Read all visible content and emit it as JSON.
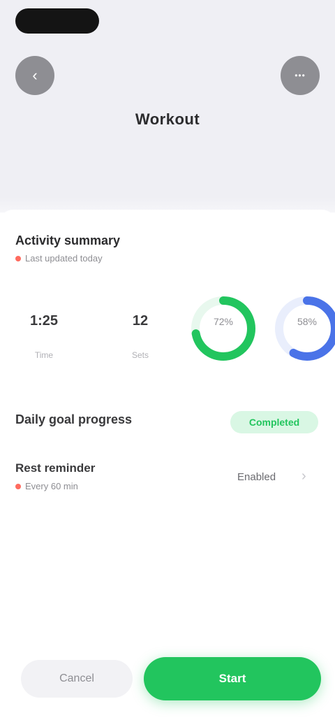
{
  "colors": {
    "accent_green": "#22c55e",
    "accent_blue": "#4a73e8",
    "warning_dot": "#ff6b5f",
    "top_background": "#efeff4"
  },
  "header": {
    "left_icon": "chevron-left-icon",
    "left_glyph": "‹",
    "right_icon": "more-icon",
    "right_glyph": "•••",
    "title": "Workout"
  },
  "summary": {
    "title": "Activity summary",
    "subtitle": "Last updated today"
  },
  "stats": [
    {
      "value": "1:25",
      "label": "Time"
    },
    {
      "value": "12",
      "label": "Sets"
    }
  ],
  "rings": [
    {
      "name": "move",
      "progress": 0.72,
      "text": "72%"
    },
    {
      "name": "exercise",
      "progress": 0.58,
      "text": "58%"
    }
  ],
  "rows": {
    "goal_label": "Daily goal progress",
    "goal_status": "Completed",
    "rest_label": "Rest reminder",
    "rest_sub": "Every 60 min",
    "rest_value": "Enabled"
  },
  "actions": {
    "secondary": "Cancel",
    "primary": "Start"
  }
}
